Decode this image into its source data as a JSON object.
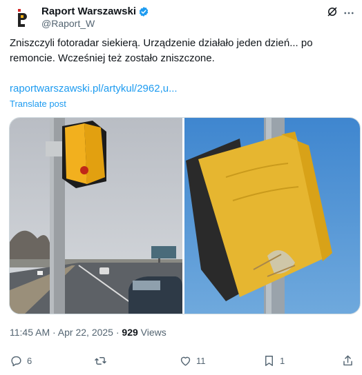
{
  "author": {
    "name": "Raport Warszawski",
    "handle": "@Raport_W"
  },
  "tweet": {
    "text": "Zniszczyli fotoradar siekierą. Urządzenie działało jeden dzień... po\nremoncie. Wcześniej też zostało zniszczone.",
    "link": "raportwarszawski.pl/artykul/2962,u...",
    "translate_label": "Translate post"
  },
  "meta": {
    "time": "11:45 AM",
    "separator": " · ",
    "date": "Apr 22, 2025",
    "views_count": "929",
    "views_label": " Views"
  },
  "actions": {
    "replies": "6",
    "likes": "11",
    "bookmarks": "1"
  },
  "icons": [
    "verified-badge-icon",
    "grok-icon",
    "more-icon",
    "reply-icon",
    "retweet-icon",
    "like-icon",
    "bookmark-icon",
    "share-icon"
  ],
  "colors": {
    "accent": "#1d9bf0",
    "muted": "#536471",
    "text": "#0f1419"
  }
}
